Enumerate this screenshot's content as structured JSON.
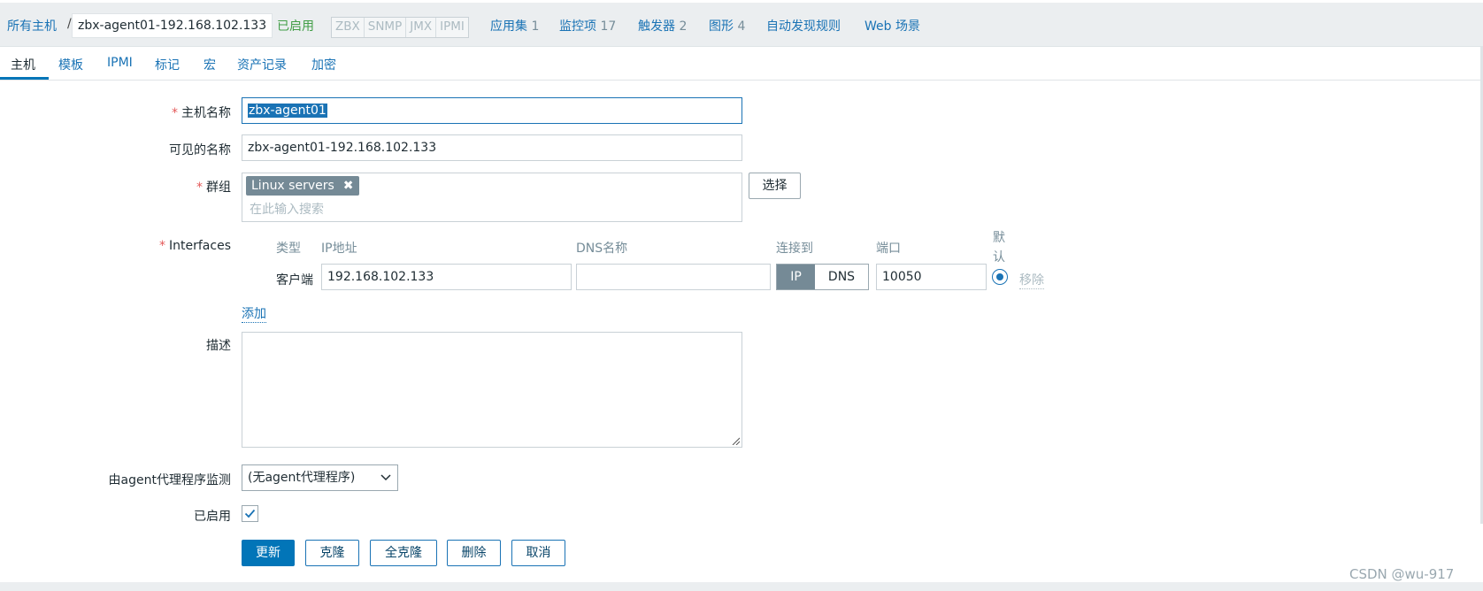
{
  "breadcrumb": {
    "all_hosts": "所有主机",
    "separator": "/",
    "current": "zbx-agent01-192.168.102.133"
  },
  "host_status": "已启用",
  "availability": [
    "ZBX",
    "SNMP",
    "JMX",
    "IPMI"
  ],
  "host_nav": [
    {
      "label": "应用集",
      "count": "1"
    },
    {
      "label": "监控项",
      "count": "17"
    },
    {
      "label": "触发器",
      "count": "2"
    },
    {
      "label": "图形",
      "count": "4"
    },
    {
      "label": "自动发现规则",
      "count": ""
    },
    {
      "label": "Web 场景",
      "count": ""
    }
  ],
  "tabs": [
    "主机",
    "模板",
    "IPMI",
    "标记",
    "宏",
    "资产记录",
    "加密"
  ],
  "active_tab": "主机",
  "form": {
    "host_name_label": "主机名称",
    "host_name_value": "zbx-agent01",
    "visible_name_label": "可见的名称",
    "visible_name_value": "zbx-agent01-192.168.102.133",
    "groups_label": "群组",
    "group_chip": "Linux servers",
    "group_chip_remove": "✖",
    "groups_placeholder": "在此输入搜索",
    "select_button": "选择",
    "interfaces_label": "Interfaces",
    "interface_columns": {
      "type": "类型",
      "ip": "IP地址",
      "dns": "DNS名称",
      "connect": "连接到",
      "port": "端口",
      "default_line1": "默",
      "default_line2": "认"
    },
    "interface_row": {
      "type": "客户端",
      "ip": "192.168.102.133",
      "dns": "",
      "connect_ip": "IP",
      "connect_dns": "DNS",
      "port": "10050",
      "remove": "移除"
    },
    "add_link": "添加",
    "description_label": "描述",
    "description_value": "",
    "proxy_label": "由agent代理程序监测",
    "proxy_value": "(无agent代理程序)",
    "enabled_label": "已启用",
    "enabled_checked": true
  },
  "buttons": {
    "update": "更新",
    "clone": "克隆",
    "full_clone": "全克隆",
    "delete": "删除",
    "cancel": "取消"
  },
  "watermark": "CSDN @wu-917",
  "colors": {
    "primary": "#0275b8",
    "link": "#1a73b5",
    "status_green": "#429e47",
    "required": "#e45959"
  }
}
